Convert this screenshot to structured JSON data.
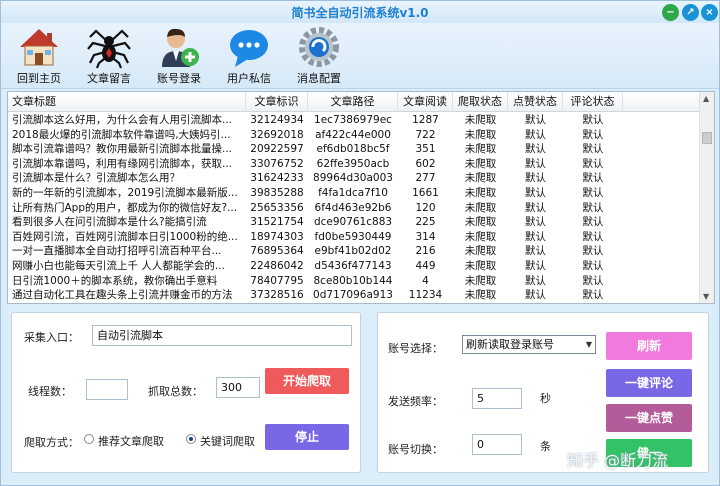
{
  "window": {
    "title": "简书全自动引流系统v1.0"
  },
  "toolbar": [
    {
      "label": "回到主页",
      "icon": "home-icon"
    },
    {
      "label": "文章留言",
      "icon": "spider-icon"
    },
    {
      "label": "账号登录",
      "icon": "user-add-icon"
    },
    {
      "label": "用户私信",
      "icon": "chat-icon"
    },
    {
      "label": "消息配置",
      "icon": "settings-icon"
    }
  ],
  "table": {
    "columns": [
      "文章标题",
      "文章标识",
      "文章路径",
      "文章阅读",
      "爬取状态",
      "点赞状态",
      "评论状态"
    ],
    "rows": [
      [
        "引流脚本这么好用，为什么会有人用引流脚本...",
        "32124934",
        "1ec7386979ec",
        "1287",
        "未爬取",
        "默认",
        "默认"
      ],
      [
        "2018最火爆的引流脚本软件靠谱吗,大姨妈引...",
        "32692018",
        "af422c44e000",
        "722",
        "未爬取",
        "默认",
        "默认"
      ],
      [
        "脚本引流靠谱吗？教你用最新引流脚本批量操...",
        "20922597",
        "ef6db018bc5f",
        "351",
        "未爬取",
        "默认",
        "默认"
      ],
      [
        "引流脚本靠谱吗，利用有缘网引流脚本，获取...",
        "33076752",
        "62ffe3950acb",
        "602",
        "未爬取",
        "默认",
        "默认"
      ],
      [
        "引流脚本是什么？引流脚本怎么用？",
        "31624233",
        "89964d30a003",
        "277",
        "未爬取",
        "默认",
        "默认"
      ],
      [
        "新的一年新的引流脚本，2019引流脚本最新版...",
        "39835288",
        "f4fa1dca7f10",
        "1661",
        "未爬取",
        "默认",
        "默认"
      ],
      [
        "让所有热门App的用户，都成为你的微信好友?...",
        "25653356",
        "6f4d463e92b6",
        "120",
        "未爬取",
        "默认",
        "默认"
      ],
      [
        "看到很多人在问引流脚本是什么?能搞引流",
        "31521754",
        "dce90761c883",
        "225",
        "未爬取",
        "默认",
        "默认"
      ],
      [
        "百姓网引流，百姓网引流脚本日引1000粉的绝...",
        "18974303",
        "fd0be5930449",
        "314",
        "未爬取",
        "默认",
        "默认"
      ],
      [
        "一对一直播脚本全自动打招呼引流百种平台...",
        "76895364",
        "e9bf41b02d02",
        "216",
        "未爬取",
        "默认",
        "默认"
      ],
      [
        "网赚小白也能每天引流上千 人人都能学会的...",
        "22486042",
        "d5436f477143",
        "449",
        "未爬取",
        "默认",
        "默认"
      ],
      [
        "日引流1000＋的脚本系统，教你确出手意料",
        "78407795",
        "8ce80b10b144",
        "4",
        "未爬取",
        "默认",
        "默认"
      ],
      [
        "通过自动化工具在趣头条上引流并赚金币的方法",
        "37328516",
        "0d717096a913",
        "11234",
        "未爬取",
        "默认",
        "默认"
      ]
    ]
  },
  "left_panel": {
    "collect_label": "采集入口：",
    "collect_value": "自动引流脚本",
    "threads_label": "线程数：",
    "threads_value": "",
    "total_label": "抓取总数：",
    "total_value": "300",
    "start_button": "开始爬取",
    "mode_label": "爬取方式：",
    "radio_recommend": "推荐文章爬取",
    "radio_keyword": "关键词爬取",
    "stop_button": "停止"
  },
  "right_panel": {
    "account_label": "账号选择：",
    "account_value": "刷新读取登录账号",
    "freq_label": "发送频率：",
    "freq_value": "5",
    "freq_unit": "秒",
    "switch_label": "账号切换：",
    "switch_value": "0",
    "switch_unit": "条",
    "refresh_button": "刷新",
    "comment_button": "一键评论",
    "like_button": "一键点赞",
    "last_button": "健一"
  },
  "watermark": "知乎 @断刀流",
  "colors": {
    "start": "#ef5a5a",
    "stop": "#7968e6",
    "refresh": "#f27adf",
    "comment": "#7968e6",
    "like": "#b45b9a",
    "last": "#33c266"
  }
}
